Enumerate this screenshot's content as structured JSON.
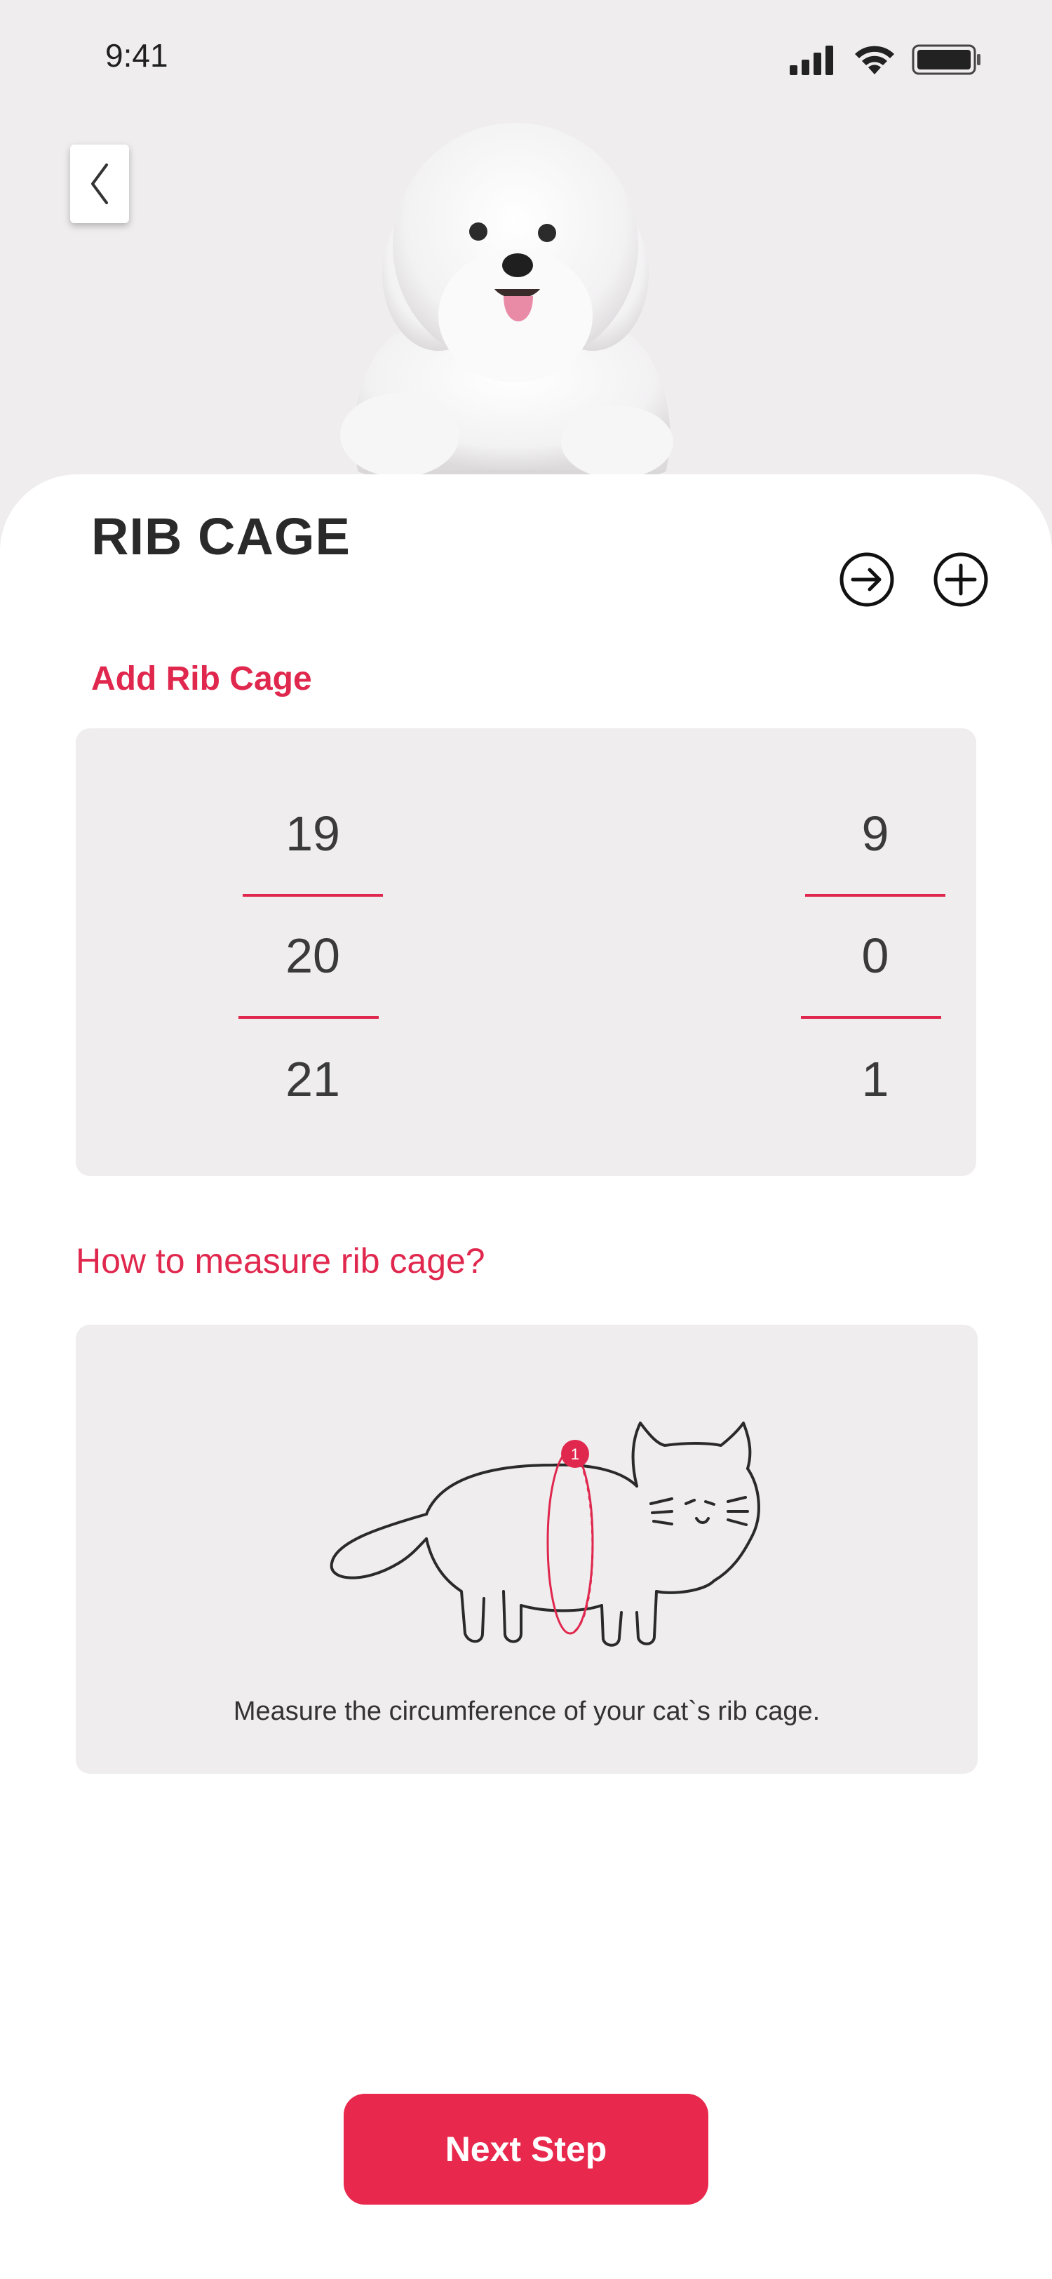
{
  "status_bar": {
    "time": "9:41"
  },
  "header": {
    "title": "RIB CAGE"
  },
  "picker": {
    "label": "Add Rib Cage",
    "left_values": [
      "19",
      "20",
      "21"
    ],
    "right_values": [
      "9",
      "0",
      "1"
    ]
  },
  "guide": {
    "heading": "How to measure rib cage?",
    "marker": "1",
    "caption": "Measure the circumference of your cat`s rib cage."
  },
  "footer": {
    "next_label": "Next Step"
  },
  "colors": {
    "accent": "#e8294d",
    "panel": "#efedee",
    "background": "#ffffff"
  },
  "icons": [
    "back-chevron-icon",
    "arrow-right-circle-icon",
    "plus-circle-icon",
    "cellular-signal-icon",
    "wifi-icon",
    "battery-icon"
  ]
}
